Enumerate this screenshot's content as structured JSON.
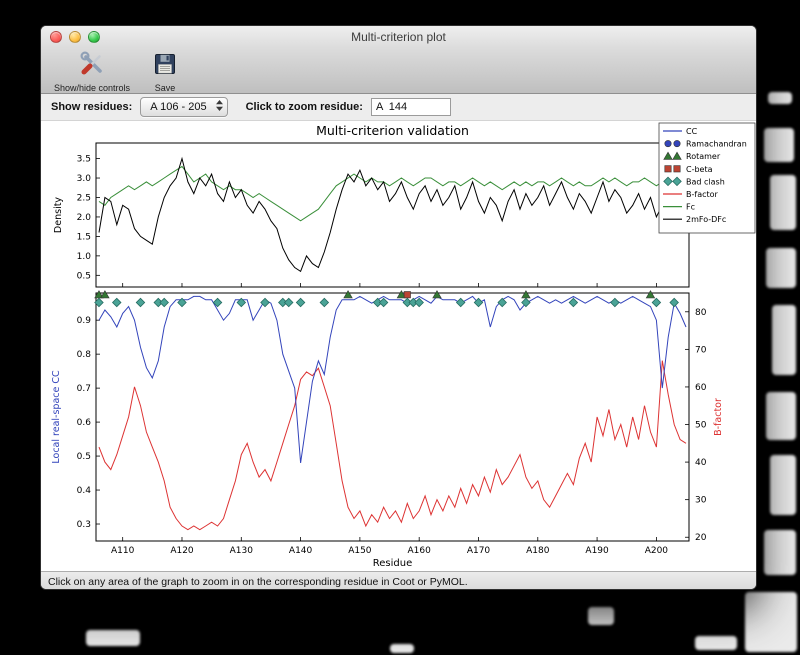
{
  "window": {
    "title": "Multi-criterion plot"
  },
  "toolbar": {
    "show_hide_label": "Show/hide controls",
    "save_label": "Save"
  },
  "controls": {
    "show_residues_label": "Show residues:",
    "residue_range_value": "A 106 - 205",
    "zoom_residue_label": "Click to zoom residue:",
    "zoom_residue_value": "A  144"
  },
  "status_bar": {
    "text": "Click on any area of the graph to zoom in on the corresponding residue in Coot or PyMOL."
  },
  "chart_data": {
    "type": "line",
    "title": "Multi-criterion validation",
    "xlabel": "Residue",
    "x_start": 106,
    "xlim": [
      105.5,
      205.5
    ],
    "x_ticks": [
      110,
      120,
      130,
      140,
      150,
      160,
      170,
      180,
      190,
      200
    ],
    "x_tick_labels": [
      "A110",
      "A120",
      "A130",
      "A140",
      "A150",
      "A160",
      "A170",
      "A180",
      "A190",
      "A200"
    ],
    "top_plot": {
      "ylabel": "Density",
      "ylim": [
        0.2,
        3.9
      ],
      "yticks": [
        0.5,
        1.0,
        1.5,
        2.0,
        2.5,
        3.0,
        3.5
      ],
      "series": [
        {
          "name": "Fc",
          "color": "#3a8f3a",
          "values": [
            2.4,
            2.3,
            2.5,
            2.6,
            2.7,
            2.8,
            2.7,
            2.8,
            2.9,
            2.8,
            2.9,
            3.0,
            3.1,
            3.2,
            3.3,
            3.1,
            2.9,
            3.0,
            3.1,
            2.9,
            2.8,
            2.7,
            2.8,
            2.7,
            2.7,
            2.6,
            2.5,
            2.6,
            2.5,
            2.4,
            2.3,
            2.2,
            2.1,
            2.0,
            1.9,
            2.0,
            2.1,
            2.2,
            2.4,
            2.6,
            2.8,
            2.9,
            3.0,
            3.1,
            3.0,
            2.9,
            3.0,
            2.9,
            2.9,
            2.8,
            2.9,
            3.0,
            2.9,
            2.8,
            2.9,
            3.0,
            3.0,
            2.9,
            2.8,
            2.9,
            2.9,
            2.8,
            2.9,
            3.0,
            2.9,
            2.8,
            2.9,
            2.8,
            2.7,
            2.8,
            2.9,
            2.8,
            2.9,
            2.8,
            2.9,
            2.9,
            2.8,
            2.9,
            3.0,
            2.9,
            2.8,
            2.9,
            2.8,
            2.8,
            2.9,
            3.0,
            2.9,
            3.0,
            2.9,
            2.8,
            2.9,
            2.9,
            3.0,
            2.9,
            2.8,
            2.9,
            2.8,
            2.9,
            3.0,
            2.9
          ]
        },
        {
          "name": "2mFo-DFc",
          "color": "#000000",
          "values": [
            1.6,
            2.5,
            2.4,
            1.8,
            2.3,
            2.2,
            1.7,
            1.5,
            1.4,
            1.3,
            2.0,
            2.5,
            2.8,
            3.0,
            3.5,
            2.9,
            2.6,
            3.0,
            2.8,
            3.1,
            2.6,
            2.4,
            2.9,
            2.5,
            2.7,
            2.3,
            2.1,
            2.4,
            2.2,
            1.9,
            1.7,
            1.2,
            0.9,
            0.7,
            0.6,
            1.0,
            0.8,
            0.7,
            1.1,
            1.6,
            2.2,
            2.7,
            3.1,
            2.9,
            3.2,
            2.8,
            3.0,
            2.7,
            2.9,
            2.4,
            2.6,
            2.9,
            2.5,
            2.2,
            2.6,
            2.8,
            2.4,
            2.7,
            2.3,
            2.5,
            2.8,
            2.2,
            2.5,
            2.9,
            2.4,
            2.1,
            2.5,
            2.3,
            1.9,
            2.4,
            2.7,
            2.2,
            2.6,
            2.3,
            2.5,
            2.8,
            2.3,
            2.6,
            2.9,
            2.5,
            2.2,
            2.6,
            2.4,
            2.1,
            2.5,
            2.9,
            2.4,
            2.7,
            2.5,
            2.1,
            2.3,
            2.6,
            2.2,
            2.5,
            2.0,
            2.3,
            1.9,
            2.4,
            2.6,
            2.3
          ]
        }
      ]
    },
    "bottom_plot": {
      "ylabel_left": "Local real-space CC",
      "ylabel_left_color": "#3344bb",
      "ylabel_right": "B-factor",
      "ylabel_right_color": "#dd3333",
      "ylim_left": [
        0.25,
        0.98
      ],
      "yticks_left": [
        0.3,
        0.4,
        0.5,
        0.6,
        0.7,
        0.8,
        0.9
      ],
      "ylim_right": [
        19,
        85
      ],
      "yticks_right": [
        20,
        30,
        40,
        50,
        60,
        70,
        80
      ],
      "cc": {
        "name": "CC",
        "color": "#3344bb",
        "values": [
          0.9,
          0.93,
          0.91,
          0.88,
          0.92,
          0.94,
          0.9,
          0.82,
          0.76,
          0.73,
          0.78,
          0.88,
          0.94,
          0.96,
          0.96,
          0.96,
          0.97,
          0.97,
          0.96,
          0.96,
          0.93,
          0.9,
          0.92,
          0.96,
          0.96,
          0.96,
          0.9,
          0.93,
          0.96,
          0.95,
          0.9,
          0.8,
          0.75,
          0.7,
          0.48,
          0.6,
          0.72,
          0.78,
          0.74,
          0.85,
          0.93,
          0.96,
          0.96,
          0.96,
          0.97,
          0.96,
          0.95,
          0.96,
          0.97,
          0.96,
          0.96,
          0.96,
          0.95,
          0.96,
          0.97,
          0.96,
          0.95,
          0.97,
          0.96,
          0.96,
          0.96,
          0.95,
          0.96,
          0.97,
          0.95,
          0.96,
          0.88,
          0.94,
          0.96,
          0.97,
          0.96,
          0.93,
          0.95,
          0.96,
          0.97,
          0.96,
          0.95,
          0.96,
          0.95,
          0.96,
          0.97,
          0.96,
          0.95,
          0.96,
          0.97,
          0.96,
          0.95,
          0.96,
          0.95,
          0.96,
          0.97,
          0.96,
          0.95,
          0.94,
          0.9,
          0.7,
          0.85,
          0.95,
          0.92,
          0.88
        ]
      },
      "bfactor": {
        "name": "B-factor",
        "color": "#dd3333",
        "values": [
          44,
          40,
          38,
          42,
          47,
          52,
          60,
          55,
          48,
          44,
          40,
          35,
          28,
          25,
          23,
          22,
          23,
          22,
          23,
          24,
          23,
          25,
          30,
          35,
          42,
          45,
          40,
          36,
          38,
          35,
          40,
          45,
          50,
          55,
          62,
          64,
          63,
          65,
          60,
          55,
          45,
          35,
          28,
          25,
          27,
          23,
          26,
          24,
          28,
          25,
          27,
          24,
          29,
          25,
          27,
          31,
          26,
          30,
          27,
          31,
          28,
          33,
          29,
          34,
          31,
          36,
          32,
          38,
          34,
          36,
          39,
          42,
          36,
          33,
          35,
          30,
          28,
          31,
          34,
          37,
          34,
          41,
          45,
          40,
          52,
          47,
          54,
          46,
          50,
          44,
          52,
          46,
          55,
          48,
          44,
          67,
          58,
          50,
          46,
          45
        ]
      },
      "markers": {
        "ramachandran": {
          "label": "Ramachandran",
          "shape": "circle",
          "color": "#3344bb",
          "residues": []
        },
        "rotamer": {
          "label": "Rotamer",
          "shape": "triangle",
          "color": "#337733",
          "residues": [
            106,
            107,
            148,
            157,
            163,
            178,
            199
          ]
        },
        "cbeta": {
          "label": "C-beta",
          "shape": "square",
          "color": "#bb4433",
          "residues": [
            158
          ]
        },
        "clash": {
          "label": "Bad clash",
          "shape": "diamond",
          "color": "#4aa396",
          "residues": [
            106,
            109,
            113,
            116,
            117,
            120,
            126,
            130,
            134,
            137,
            138,
            140,
            144,
            153,
            154,
            158,
            159,
            160,
            167,
            170,
            174,
            178,
            186,
            193,
            200,
            203
          ]
        }
      }
    },
    "legend": [
      {
        "label": "CC",
        "type": "line",
        "color": "#3344bb"
      },
      {
        "label": "Ramachandran",
        "type": "circle",
        "color": "#3344bb"
      },
      {
        "label": "Rotamer",
        "type": "triangle",
        "color": "#337733"
      },
      {
        "label": "C-beta",
        "type": "square",
        "color": "#bb4433"
      },
      {
        "label": "Bad clash",
        "type": "diamond",
        "color": "#4aa396"
      },
      {
        "label": "B-factor",
        "type": "line",
        "color": "#dd3333"
      },
      {
        "label": "Fc",
        "type": "line",
        "color": "#3a8f3a"
      },
      {
        "label": "2mFo-DFc",
        "type": "line",
        "color": "#000000"
      }
    ]
  }
}
